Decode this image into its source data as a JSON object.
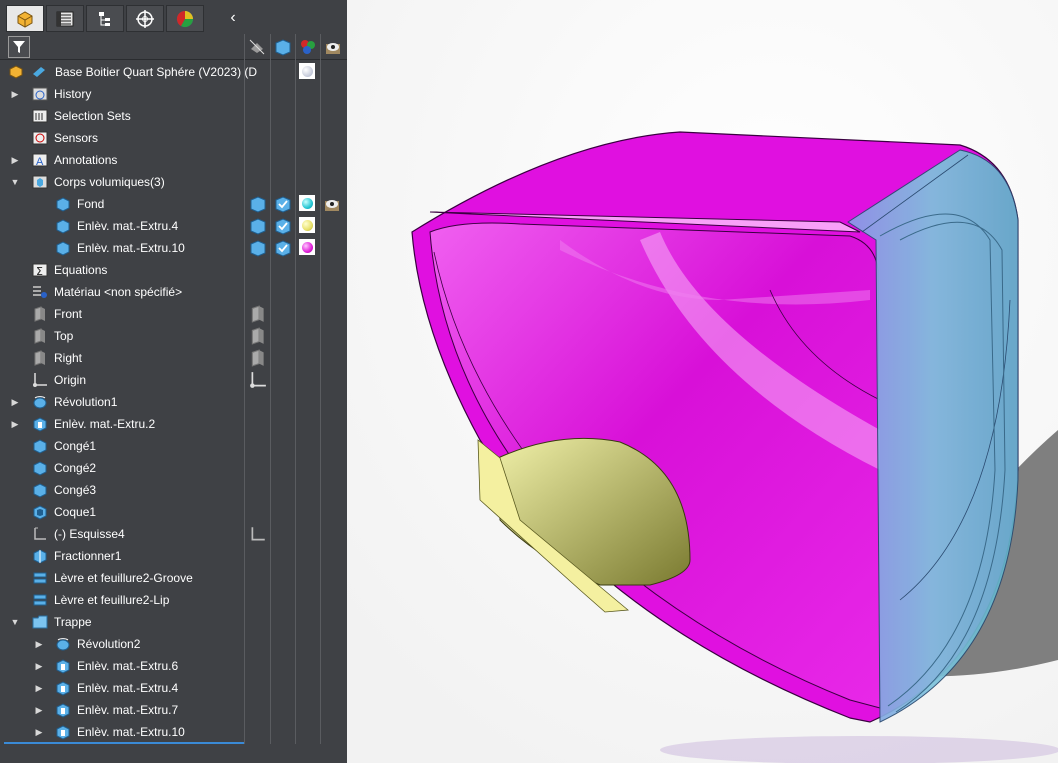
{
  "feature_tree": {
    "root": "Base Boitier Quart Sphére (V2023) (D",
    "items": [
      {
        "label": "History"
      },
      {
        "label": "Selection Sets"
      },
      {
        "label": "Sensors"
      },
      {
        "label": "Annotations"
      },
      {
        "label": "Corps volumiques(3)"
      },
      {
        "label": "Fond"
      },
      {
        "label": "Enlèv. mat.-Extru.4"
      },
      {
        "label": "Enlèv. mat.-Extru.10"
      },
      {
        "label": "Equations"
      },
      {
        "label": "Matériau <non spécifié>"
      },
      {
        "label": "Front"
      },
      {
        "label": "Top"
      },
      {
        "label": "Right"
      },
      {
        "label": "Origin"
      },
      {
        "label": "Révolution1"
      },
      {
        "label": "Enlèv. mat.-Extru.2"
      },
      {
        "label": "Congé1"
      },
      {
        "label": "Congé2"
      },
      {
        "label": "Congé3"
      },
      {
        "label": "Coque1"
      },
      {
        "label": "(-) Esquisse4"
      },
      {
        "label": "Fractionner1"
      },
      {
        "label": "Lèvre et feuillure2-Groove"
      },
      {
        "label": "Lèvre et feuillure2-Lip"
      },
      {
        "label": "Trappe"
      },
      {
        "label": "Révolution2"
      },
      {
        "label": "Enlèv. mat.-Extru.6"
      },
      {
        "label": "Enlèv. mat.-Extru.4"
      },
      {
        "label": "Enlèv. mat.-Extru.7"
      },
      {
        "label": "Enlèv. mat.-Extru.10"
      }
    ]
  },
  "tabs": [
    {
      "icon": "feature-manager-icon",
      "active": true
    },
    {
      "icon": "property-manager-icon"
    },
    {
      "icon": "configuration-manager-icon"
    },
    {
      "icon": "dimxpert-icon"
    },
    {
      "icon": "display-manager-icon"
    }
  ],
  "colors": {
    "panel_bg": "#3f4145",
    "body_fond": "#26c6d3",
    "body_extru4": "#e8e06a",
    "body_extru10": "#e020d8",
    "model_magenta": "#e010e0",
    "model_cyan": "#6fc8d2",
    "model_yellow": "#d8d888"
  }
}
